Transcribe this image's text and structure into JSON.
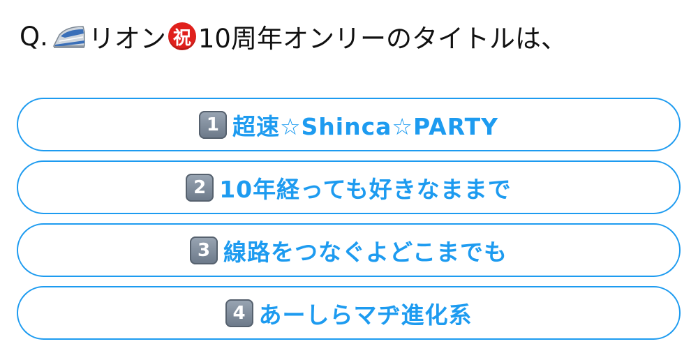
{
  "question": {
    "prefix": "Q.",
    "text_part1": "リオン",
    "iwai_glyph": "祝",
    "text_part2": "10周年オンリーのタイトルは、",
    "train_icon": "bullet-train-icon",
    "celebrate_icon": "congratulations-icon"
  },
  "colors": {
    "accent": "#1d9bf0",
    "text": "#111111",
    "badge": "#7a8696",
    "iwai": "#e0201c"
  },
  "options": [
    {
      "number": "1",
      "label": "超速☆Shinca☆PARTY"
    },
    {
      "number": "2",
      "label": "10年経っても好きなままで"
    },
    {
      "number": "3",
      "label": "線路をつなぐよどこまでも"
    },
    {
      "number": "4",
      "label": "あーしらマヂ進化系"
    }
  ]
}
